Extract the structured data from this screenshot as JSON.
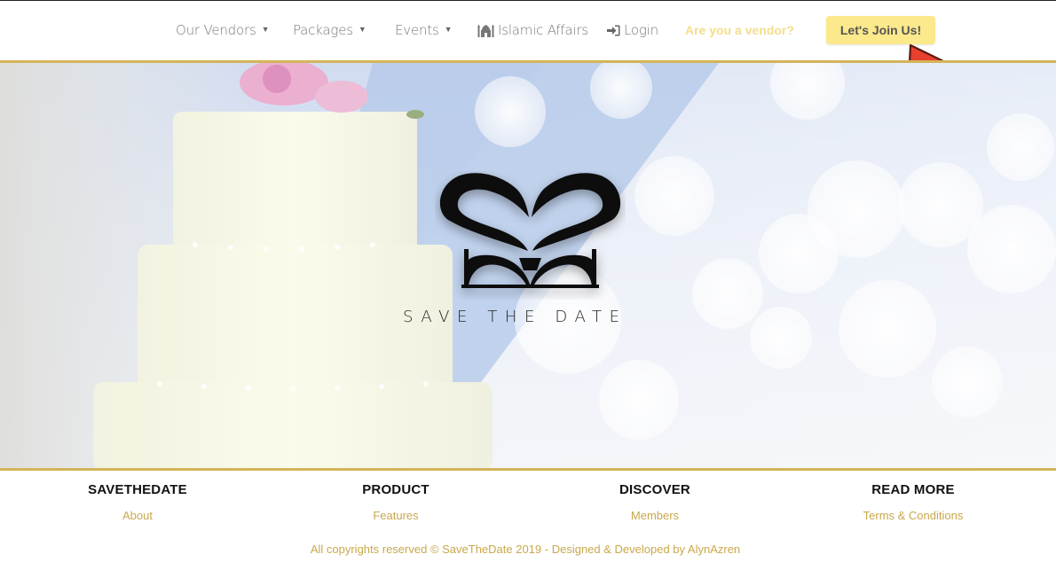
{
  "nav": {
    "vendors_label": "Our Vendors",
    "packages_label": "Packages",
    "events_label": "Events",
    "islamic_label": "Islamic Affairs",
    "login_label": "Login",
    "vendor_question": "Are you a vendor?",
    "join_label": "Let's Join Us!"
  },
  "icons": {
    "dropdown": "chevron-down-icon",
    "islamic": "mosque-icon",
    "login": "sign-in-icon",
    "pointer": "red-arrow-pointer-icon"
  },
  "hero": {
    "tagline": "SAVE THE DATE",
    "logo": "save-the-date-monogram-logo"
  },
  "footer": {
    "columns": [
      {
        "heading": "SAVETHEDATE",
        "link": "About"
      },
      {
        "heading": "PRODUCT",
        "link": "Features"
      },
      {
        "heading": "DISCOVER",
        "link": "Members"
      },
      {
        "heading": "READ MORE",
        "link": "Terms & Conditions"
      }
    ],
    "copyright": "All copyrights reserved © SaveTheDate 2019 - Designed & Developed by AlynAzren"
  },
  "colors": {
    "accent_gold": "#d4b45a",
    "link_gold": "#c9a84c",
    "join_button": "#fbe98b",
    "vendor_question": "#f2de8c",
    "pointer_red": "#e8402f"
  }
}
